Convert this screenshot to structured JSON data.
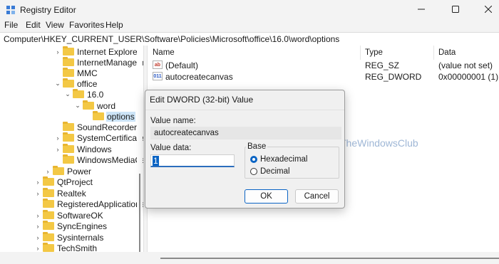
{
  "window": {
    "title": "Registry Editor"
  },
  "icons": {
    "app": "registry-editor-icon",
    "minimize": "minimize-icon",
    "maximize": "maximize-icon",
    "close": "close-icon",
    "folder": "folder-icon",
    "string_value": "string-value-icon",
    "binary_value": "dword-value-icon"
  },
  "menu": {
    "file": "File",
    "edit": "Edit",
    "view": "View",
    "favorites": "Favorites",
    "help": "Help"
  },
  "address": "Computer\\HKEY_CURRENT_USER\\Software\\Policies\\Microsoft\\office\\16.0\\word\\options",
  "tree": {
    "items": [
      {
        "label": "Internet Explorer",
        "expander": "›"
      },
      {
        "label": "InternetManagem",
        "expander": ""
      },
      {
        "label": "MMC",
        "expander": ""
      },
      {
        "label": "office",
        "expander": "⌄"
      },
      {
        "label": "16.0",
        "expander": "⌄"
      },
      {
        "label": "word",
        "expander": "⌄"
      },
      {
        "label": "options",
        "expander": ""
      },
      {
        "label": "SoundRecorder",
        "expander": ""
      },
      {
        "label": "SystemCertificates",
        "expander": "›"
      },
      {
        "label": "Windows",
        "expander": "›"
      },
      {
        "label": "WindowsMediaCe",
        "expander": ""
      },
      {
        "label": "Power",
        "expander": "›"
      },
      {
        "label": "QtProject",
        "expander": "›"
      },
      {
        "label": "Realtek",
        "expander": "›"
      },
      {
        "label": "RegisteredApplications",
        "expander": ""
      },
      {
        "label": "SoftwareOK",
        "expander": "›"
      },
      {
        "label": "SyncEngines",
        "expander": "›"
      },
      {
        "label": "Sysinternals",
        "expander": "›"
      },
      {
        "label": "TechSmith",
        "expander": "›"
      }
    ],
    "selected": "options"
  },
  "list": {
    "columns": {
      "name": "Name",
      "type": "Type",
      "data": "Data"
    },
    "rows": [
      {
        "name": "(Default)",
        "type": "REG_SZ",
        "data": "(value not set)",
        "icon_text": "ab"
      },
      {
        "name": "autocreatecanvas",
        "type": "REG_DWORD",
        "data": "0x00000001 (1)",
        "icon_text": "011"
      }
    ]
  },
  "dialog": {
    "title": "Edit DWORD (32-bit) Value",
    "value_name_label": "Value name:",
    "value_name": "autocreatecanvas",
    "value_data_label": "Value data:",
    "value_data": "1",
    "base_label": "Base",
    "hex_label": "Hexadecimal",
    "dec_label": "Decimal",
    "selected_base": "Hexadecimal",
    "ok_label": "OK",
    "cancel_label": "Cancel"
  },
  "watermark": "TheWindowsClub"
}
